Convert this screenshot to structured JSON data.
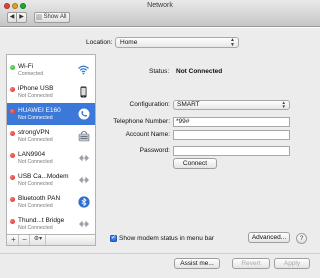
{
  "window": {
    "title": "Network"
  },
  "toolbar": {
    "back": "◀",
    "forward": "▶",
    "show_all": "Show All"
  },
  "location": {
    "label": "Location:",
    "value": "Home"
  },
  "services": [
    {
      "name": "Wi-Fi",
      "status": "Connected",
      "state": "green",
      "icon": "wifi-icon"
    },
    {
      "name": "iPhone USB",
      "status": "Not Connected",
      "state": "red",
      "icon": "iphone-icon"
    },
    {
      "name": "HUAWEI E160",
      "status": "Not Connected",
      "state": "red",
      "icon": "phone-icon",
      "selected": true
    },
    {
      "name": "strongVPN",
      "status": "Not Connected",
      "state": "red",
      "icon": "vpn-lock-icon"
    },
    {
      "name": "LAN9904",
      "status": "Not Connected",
      "state": "red",
      "icon": "ethernet-arrows-icon"
    },
    {
      "name": "USB Ca...Modem",
      "status": "Not Connected",
      "state": "red",
      "icon": "ethernet-arrows-icon"
    },
    {
      "name": "Bluetooth PAN",
      "status": "Not Connected",
      "state": "red",
      "icon": "bluetooth-icon"
    },
    {
      "name": "Thund...t Bridge",
      "status": "Not Connected",
      "state": "red",
      "icon": "ethernet-arrows-icon"
    }
  ],
  "sidebar_toolbar": {
    "add": "+",
    "remove": "−",
    "action": "⚙▾"
  },
  "detail": {
    "status_label": "Status:",
    "status_value": "Not Connected",
    "configuration_label": "Configuration:",
    "configuration_value": "SMART",
    "telephone_label": "Telephone Number:",
    "telephone_value": "*99#",
    "account_label": "Account Name:",
    "account_value": "",
    "password_label": "Password:",
    "password_value": "",
    "connect_button": "Connect"
  },
  "footer": {
    "show_modem_status": "Show modem status in menu bar",
    "show_modem_checked": true,
    "advanced_button": "Advanced...",
    "help_button": "?",
    "assist_button": "Assist me...",
    "revert_button": "Revert",
    "apply_button": "Apply"
  },
  "colors": {
    "selection": "#3b78d8",
    "status_green": "#29a81f",
    "status_red": "#d1241b"
  }
}
